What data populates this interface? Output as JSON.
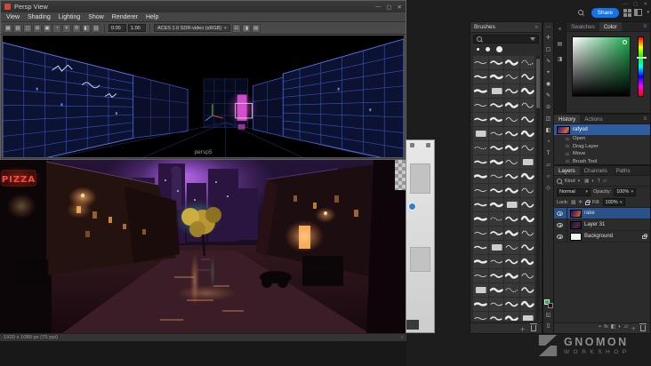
{
  "glyphs": {
    "chevron_down": "▾",
    "double_chevron": "»",
    "menu": "≡",
    "plus": "＋",
    "ellipsis": "⋯",
    "arrow_right": "›",
    "mask": "◱",
    "screen": "▯"
  },
  "maya": {
    "window_title": "Persp View",
    "menus": [
      "View",
      "Shading",
      "Lighting",
      "Show",
      "Renderer",
      "Help"
    ],
    "toolbar": {
      "icon_glyphs": [
        "▦",
        "▧",
        "◫",
        "⊞",
        "▣",
        "◔",
        "☀",
        "⚙",
        "◧",
        "▥"
      ],
      "exposure": "0.00",
      "gamma": "1.00",
      "colorspace": "ACES 1.0 SDR-video (sRGB)",
      "trailing_icon_glyphs": [
        "⊡",
        "◨",
        "▤"
      ]
    },
    "window_controls": {
      "minimize": "—",
      "maximize": "▢",
      "close": "✕"
    },
    "viewport_camera_label": "persp5"
  },
  "canvas": {
    "status_text": "1920 x 1080 px (75 ppi)"
  },
  "photoshop": {
    "window_controls": {
      "minimize": "—",
      "maximize": "▢",
      "close": "✕"
    },
    "share_button": "Share",
    "brushes": {
      "title": "Brushes",
      "tile_count": 80
    },
    "tools": [
      {
        "name": "move-tool-icon",
        "glyph": "✛"
      },
      {
        "name": "marquee-tool-icon",
        "glyph": "▢"
      },
      {
        "name": "lasso-tool-icon",
        "glyph": "∿"
      },
      {
        "name": "crop-tool-icon",
        "glyph": "⌖"
      },
      {
        "name": "eyedropper-tool-icon",
        "glyph": "◉"
      },
      {
        "name": "brush-tool-icon",
        "glyph": "✎"
      },
      {
        "name": "clone-stamp-tool-icon",
        "glyph": "⊙"
      },
      {
        "name": "eraser-tool-icon",
        "glyph": "◫"
      },
      {
        "name": "gradient-tool-icon",
        "glyph": "◧"
      },
      {
        "name": "dodge-tool-icon",
        "glyph": "◔"
      },
      {
        "name": "type-tool-icon",
        "glyph": "T"
      },
      {
        "name": "shape-tool-icon",
        "glyph": "▱"
      },
      {
        "name": "hand-tool-icon",
        "glyph": "○"
      },
      {
        "name": "zoom-tool-icon",
        "glyph": "◇"
      }
    ],
    "dock_icons": [
      "«",
      "▤",
      "◨"
    ],
    "color_panel": {
      "tabs": [
        "Swatches",
        "Color"
      ]
    },
    "history": {
      "tabs": [
        "History",
        "Actions"
      ],
      "snapshot_name": "rafyod",
      "steps": [
        "Open",
        "Drag Layer",
        "Move",
        "Brush Tool"
      ]
    },
    "layers": {
      "tabs": [
        "Layers",
        "Channels",
        "Paths"
      ],
      "filter_label": "Kind",
      "filter_icons": [
        "▦",
        "◐",
        "T",
        "▱"
      ],
      "blend_mode": "Normal",
      "opacity_label": "Opacity:",
      "opacity_value": "100%",
      "lock_label": "Lock:",
      "lock_icons": [
        "▨",
        "✛"
      ],
      "fill_label": "Fill:",
      "fill_value": "100%",
      "rows": [
        {
          "name": "rake"
        },
        {
          "name": "Layer 31"
        },
        {
          "name": "Background"
        }
      ],
      "footer_icons": [
        "⌁",
        "fx",
        "◧",
        "◐",
        "▱",
        "＋"
      ]
    }
  },
  "watermark": {
    "brand": "GNOMON",
    "sub": "WORKSHOP"
  }
}
